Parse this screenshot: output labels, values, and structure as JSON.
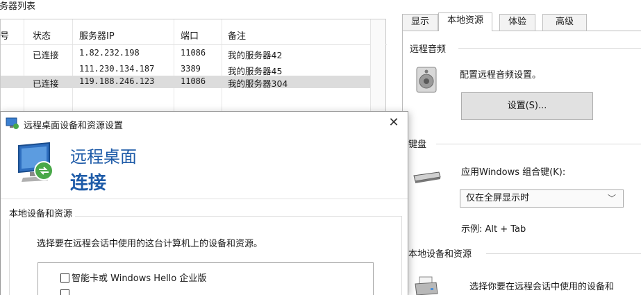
{
  "server_list": {
    "group_title": "服务器列表",
    "columns": [
      "序号",
      "状态",
      "服务器IP",
      "端口",
      "备注"
    ],
    "rows": [
      {
        "status": "已连接",
        "ip": "1.82.232.198",
        "port": "11086",
        "note": "我的服务器42"
      },
      {
        "status": "",
        "ip": "111.230.134.187",
        "port": "3389",
        "note": "我的服务器45"
      },
      {
        "status": "已连接",
        "ip": "119.188.246.123",
        "port": "11086",
        "note": "我的服务器304"
      }
    ]
  },
  "options_panel": {
    "tabs": [
      "显示",
      "本地资源",
      "体验",
      "高级"
    ],
    "active_tab": "本地资源",
    "audio": {
      "group_title": "远程音频",
      "description": "配置远程音频设置。",
      "settings_button": "设置(S)..."
    },
    "keyboard": {
      "group_title": "键盘",
      "label": "应用Windows 组合键(K):",
      "selected": "仅在全屏显示时",
      "example": "示例: Alt + Tab"
    },
    "local_devices": {
      "group_title": "本地设备和资源",
      "description": "选择你要在远程会话中使用的设备和"
    }
  },
  "dialog": {
    "title": "远程桌面设备和资源设置",
    "close_glyph": "✕",
    "banner_line1": "远程桌面",
    "banner_line2": "连接",
    "group_title": "本地设备和资源",
    "description": "选择要在远程会话中使用的这台计算机上的设备和资源。",
    "items": [
      "智能卡或 Windows Hello 企业版"
    ]
  },
  "icons": {
    "speaker": "speaker-icon",
    "keyboard": "keyboard-icon",
    "rdp": "remote-desktop-icon",
    "printer": "printer-icon"
  }
}
